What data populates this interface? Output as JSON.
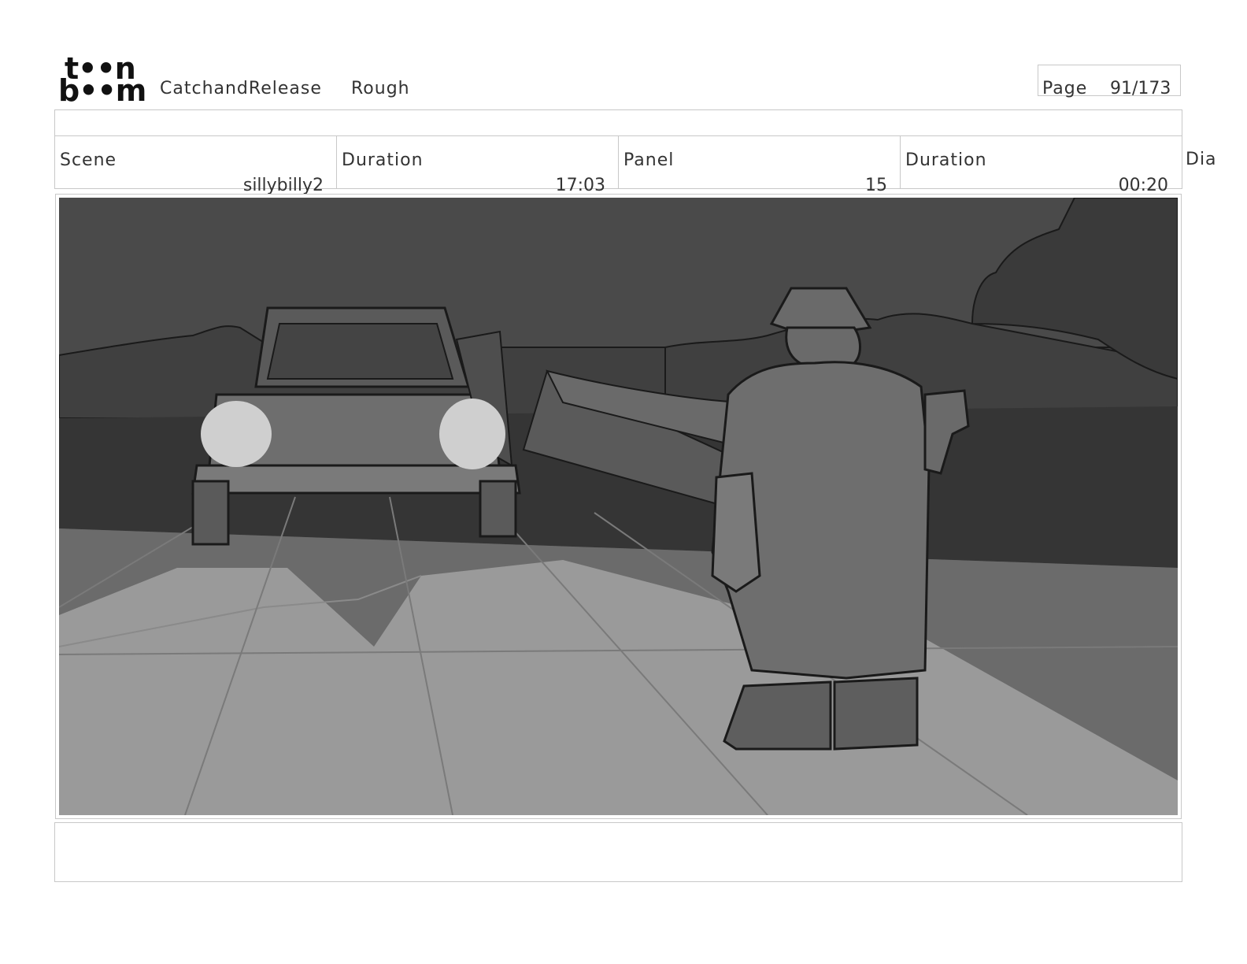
{
  "header": {
    "logo_line1": "t••n",
    "logo_line2": "b••m",
    "project_title": "CatchandRelease",
    "mode": "Rough",
    "page_label": "Page",
    "page_value": "91/173"
  },
  "info": {
    "scene_label": "Scene",
    "scene_value": "sillybilly2",
    "scene_duration_label": "Duration",
    "scene_duration_value": "17:03",
    "panel_label": "Panel",
    "panel_value": "15",
    "panel_duration_label": "Duration",
    "panel_duration_value": "00:20",
    "dialog_label": "Dia"
  },
  "panel": {
    "art_icon": "storyboard-drawing-truck-fisherman"
  }
}
